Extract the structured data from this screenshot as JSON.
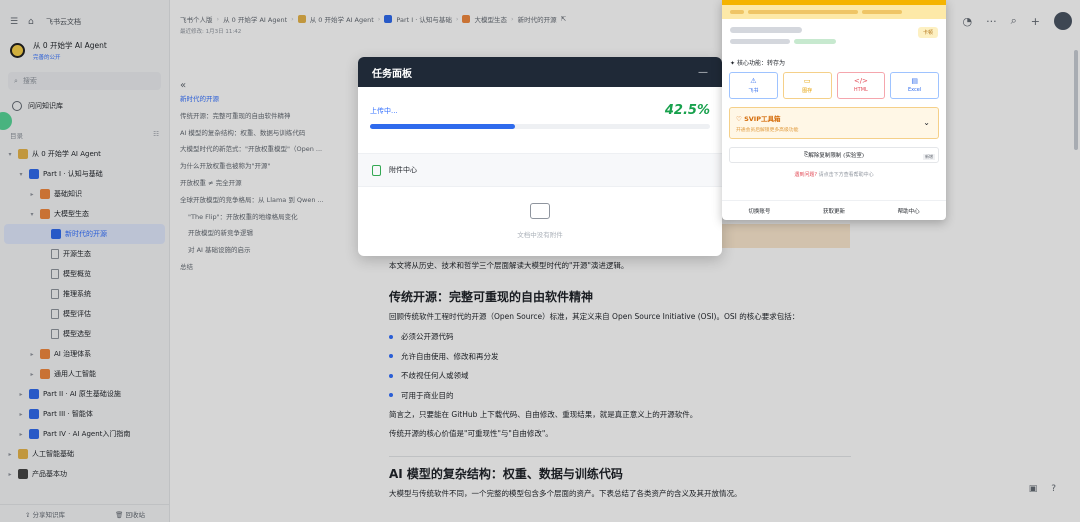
{
  "app": {
    "title": "飞书云文档"
  },
  "knowledge_base": {
    "title": "从 0 开始学 AI Agent",
    "sub": "完善的公开"
  },
  "search": {
    "placeholder": "搜索"
  },
  "qa": {
    "label": "问问知识库"
  },
  "directory": {
    "label": "目录"
  },
  "tree": [
    {
      "label": "从 0 开始学 AI Agent",
      "indent": 0,
      "arrow": "▾",
      "kind": "box",
      "color": "#e6b44a"
    },
    {
      "label": "Part I · 认知与基础",
      "indent": 1,
      "arrow": "▾",
      "kind": "box",
      "color": "#2f6bed"
    },
    {
      "label": "基础知识",
      "indent": 2,
      "arrow": "▸",
      "kind": "box",
      "color": "#f0883e"
    },
    {
      "label": "大模型生态",
      "indent": 2,
      "arrow": "▾",
      "kind": "box",
      "color": "#f0883e"
    },
    {
      "label": "新时代的开源",
      "indent": 3,
      "arrow": "",
      "kind": "box",
      "color": "#2f6bed",
      "selected": true
    },
    {
      "label": "开源生态",
      "indent": 3,
      "arrow": "",
      "kind": "doc"
    },
    {
      "label": "模型概览",
      "indent": 3,
      "arrow": "",
      "kind": "doc"
    },
    {
      "label": "推理系统",
      "indent": 3,
      "arrow": "",
      "kind": "doc"
    },
    {
      "label": "模型评估",
      "indent": 3,
      "arrow": "",
      "kind": "doc"
    },
    {
      "label": "模型选型",
      "indent": 3,
      "arrow": "",
      "kind": "doc"
    },
    {
      "label": "AI 治理体系",
      "indent": 2,
      "arrow": "▸",
      "kind": "box",
      "color": "#f0883e"
    },
    {
      "label": "通用人工智能",
      "indent": 2,
      "arrow": "▸",
      "kind": "box",
      "color": "#f0883e"
    },
    {
      "label": "Part II · AI 原生基础设施",
      "indent": 1,
      "arrow": "▸",
      "kind": "box",
      "color": "#2f6bed"
    },
    {
      "label": "Part III · 智能体",
      "indent": 1,
      "arrow": "▸",
      "kind": "box",
      "color": "#2f6bed"
    },
    {
      "label": "Part IV · AI Agent入门指南",
      "indent": 1,
      "arrow": "▸",
      "kind": "box",
      "color": "#2f6bed"
    },
    {
      "label": "人工智能基础",
      "indent": 0,
      "arrow": "▸",
      "kind": "box",
      "color": "#e6b44a"
    },
    {
      "label": "产品基本功",
      "indent": 0,
      "arrow": "▸",
      "kind": "box",
      "color": "#444444"
    }
  ],
  "sidebar_bottom": {
    "share": "分享知识库",
    "recycle": "回收站"
  },
  "breadcrumb": {
    "items": [
      "飞书个人版",
      "从 0 开始学 AI Agent",
      "从 0 开始学 AI Agent",
      "Part I · 认知与基础",
      "大模型生态",
      "新时代的开源"
    ],
    "edited": "最近修改: 1月3日 11:42"
  },
  "outline": [
    {
      "label": "新时代的开源",
      "active": true,
      "sub": false
    },
    {
      "label": "传统开源：完整可重现的自由软件精神",
      "sub": false
    },
    {
      "label": "AI 模型的复杂结构：权重、数据与训练代码",
      "sub": false
    },
    {
      "label": "大模型时代的新范式：\"开放权重模型\"（Open ...",
      "sub": false
    },
    {
      "label": "为什么开放权重也被称为\"开源\"",
      "sub": false
    },
    {
      "label": "开放权重 ≠ 完全开源",
      "sub": false
    },
    {
      "label": "全球开放模型的竞争格局：从 Llama 到 Qwen ...",
      "sub": false
    },
    {
      "label": "\"The Flip\"：开放权重的地缘格局变化",
      "sub": true
    },
    {
      "label": "开放模型的新竞争逻辑",
      "sub": true
    },
    {
      "label": "对 AI 基础设施的启示",
      "sub": true
    },
    {
      "label": "总结",
      "sub": false
    }
  ],
  "document": {
    "intro": "本文将从历史、技术和哲学三个层面解读大模型时代的\"开源\"演进逻辑。",
    "h_traditional": "传统开源：完整可重现的自由软件精神",
    "p_osi": "回顾传统软件工程时代的开源（Open Source）标准，其定义来自 Open Source Initiative (OSI)。OSI 的核心要求包括：",
    "bullets": [
      "必须公开源代码",
      "允许自由使用、修改和再分发",
      "不歧视任何人或领域",
      "可用于商业目的"
    ],
    "p_summary": "简言之，只要能在 GitHub 上下载代码、自由修改、重现结果，就是真正意义上的开源软件。",
    "p_core": "传统开源的核心价值是\"可重现性\"与\"自由修改\"。",
    "h_ai": "AI 模型的复杂结构：权重、数据与训练代码",
    "p_ai": "大模型与传统软件不同，一个完整的模型包含多个层面的资产。下表总结了各类资产的含义及其开放情况。"
  },
  "task_panel": {
    "title": "任务面板",
    "minimize": "—",
    "upload_label": "上传中...",
    "progress_percent": 42.5,
    "progress_text": "42.5%",
    "attach_label": "附件中心",
    "empty_text": "文档中没有附件"
  },
  "plugin": {
    "core_label": "核心功能：转存为",
    "buttons": [
      {
        "label": "飞书",
        "icon": "⚠",
        "color": "#2f6bed",
        "border": "#9ec3ff"
      },
      {
        "label": "图存",
        "icon": "▭",
        "color": "#e5a000",
        "border": "#f5d089"
      },
      {
        "label": "HTML",
        "icon": "</>",
        "color": "#e34d59",
        "border": "#f5a6ad"
      },
      {
        "label": "Excel",
        "icon": "▤",
        "color": "#2f6bed",
        "border": "#9ec3ff"
      }
    ],
    "tag": "卡顿",
    "svip_title": "SVIP工具箱",
    "svip_sub": "开通会员后解锁更多高级功能",
    "copy_label": "解除复制限制 (实验室)",
    "copy_badge": "新增",
    "hint_red": "遇到问题?",
    "hint_rest": "请点击下方查看帮助中心",
    "footer": [
      "切换账号",
      "获取更新",
      "帮助中心"
    ]
  },
  "colors": {
    "accent": "#3370ff",
    "progress": "#2f6bed",
    "percent": "#18a14d",
    "header_dark": "#1f2937",
    "plugin_yellow": "#f5b400"
  }
}
